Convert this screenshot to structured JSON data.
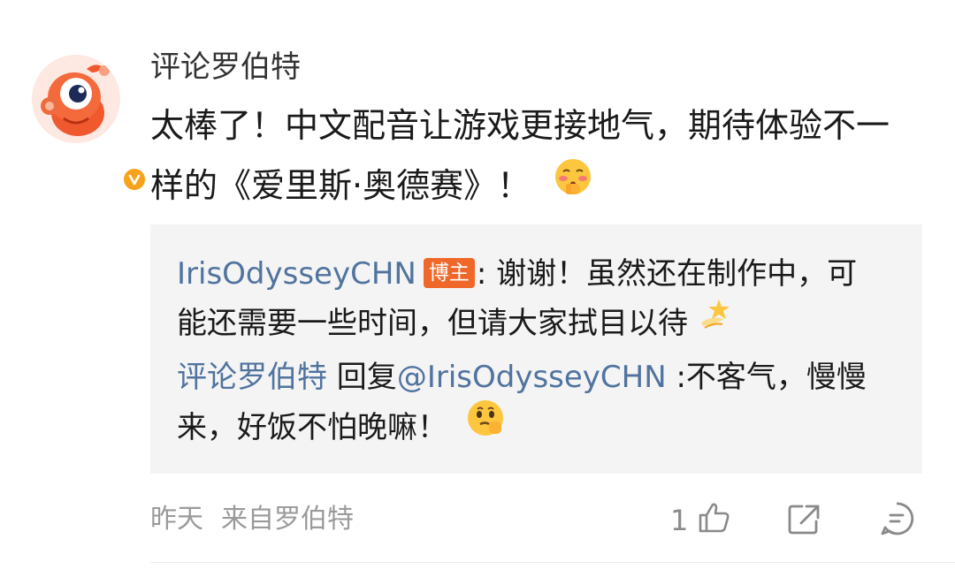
{
  "comment": {
    "username": "评论罗伯特",
    "text": "太棒了！中文配音让游戏更接地气，期待体验不一样的《爱里斯·奥德赛》！",
    "text_emoji": "shy-blush-face-icon"
  },
  "replies": [
    {
      "user": "IrisOdysseyCHN",
      "badge": "博主",
      "text": ": 谢谢！虽然还在制作中，可能还需要一些时间，但请大家拭目以待",
      "emoji": "dizzy-star-icon"
    },
    {
      "user": "评论罗伯特",
      "reply_prefix": " 回复",
      "mention": "@IrisOdysseyCHN",
      "text": " :不客气，慢慢来，好饭不怕晚嘛！",
      "emoji": "smirk-face-icon"
    }
  ],
  "footer": {
    "time": "昨天",
    "source": "来自罗伯特",
    "like_count": "1"
  },
  "colors": {
    "link": "#50739f",
    "badge": "#f0672a",
    "reply_bg": "#f4f4f4",
    "verified": "#f7a21b"
  }
}
